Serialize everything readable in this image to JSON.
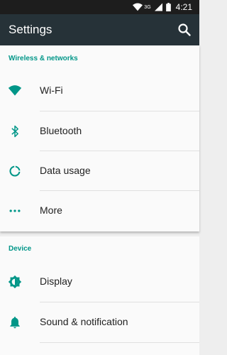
{
  "status_bar": {
    "signal_label": "3G",
    "time": "4:21"
  },
  "app_bar": {
    "title": "Settings"
  },
  "sections": [
    {
      "title": "Wireless & networks",
      "items": [
        {
          "label": "Wi-Fi",
          "icon": "wifi-icon"
        },
        {
          "label": "Bluetooth",
          "icon": "bluetooth-icon"
        },
        {
          "label": "Data usage",
          "icon": "data-usage-icon"
        },
        {
          "label": "More",
          "icon": "more-dots-icon"
        }
      ]
    },
    {
      "title": "Device",
      "items": [
        {
          "label": "Display",
          "icon": "brightness-icon"
        },
        {
          "label": "Sound & notification",
          "icon": "bell-icon"
        }
      ]
    }
  ],
  "colors": {
    "accent": "#009688",
    "app_bar": "#263238",
    "status_bar": "#1d1d1d"
  }
}
